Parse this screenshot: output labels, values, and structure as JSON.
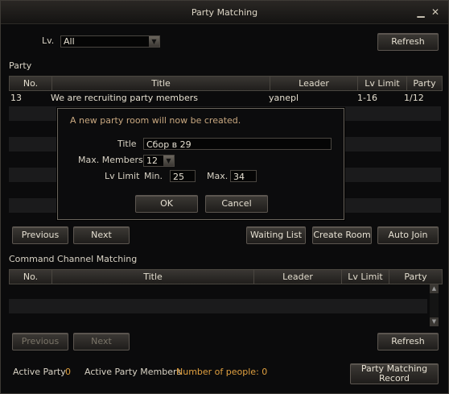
{
  "window": {
    "title": "Party Matching",
    "minimize_icon": "minimize-icon",
    "close_icon": "close-icon"
  },
  "filter": {
    "lv_label": "Lv.",
    "lv_value": "All",
    "refresh_label": "Refresh"
  },
  "party": {
    "section_label": "Party",
    "columns": [
      "No.",
      "Title",
      "Leader",
      "Lv Limit",
      "Party"
    ],
    "rows": [
      {
        "no": "13",
        "title": "We are recruiting party members",
        "leader": "yanepl",
        "lv": "1-16",
        "party": "1/12"
      }
    ],
    "previous_label": "Previous",
    "next_label": "Next",
    "waiting_list_label": "Waiting List",
    "create_room_label": "Create Room",
    "auto_join_label": "Auto Join"
  },
  "dialog": {
    "message": "A new party room will now be created.",
    "title_label": "Title",
    "title_value": "Сбор в 29",
    "max_members_label": "Max. Members",
    "max_members_value": "12",
    "lv_limit_label": "Lv Limit",
    "min_label": "Min.",
    "min_value": "25",
    "max_label": "Max.",
    "max_value": "34",
    "ok_label": "OK",
    "cancel_label": "Cancel"
  },
  "command_channel": {
    "section_label": "Command Channel Matching",
    "columns": [
      "No.",
      "Title",
      "Leader",
      "Lv Limit",
      "Party"
    ],
    "previous_label": "Previous",
    "next_label": "Next",
    "refresh_label": "Refresh"
  },
  "footer": {
    "active_party_label": "Active Party",
    "active_party_value": "0",
    "active_members_label": "Active Party Members",
    "active_members_value": "Number of people: 0",
    "record_label": "Party Matching Record"
  },
  "colors": {
    "accent": "#e0a040",
    "background": "#0b0b0c"
  }
}
